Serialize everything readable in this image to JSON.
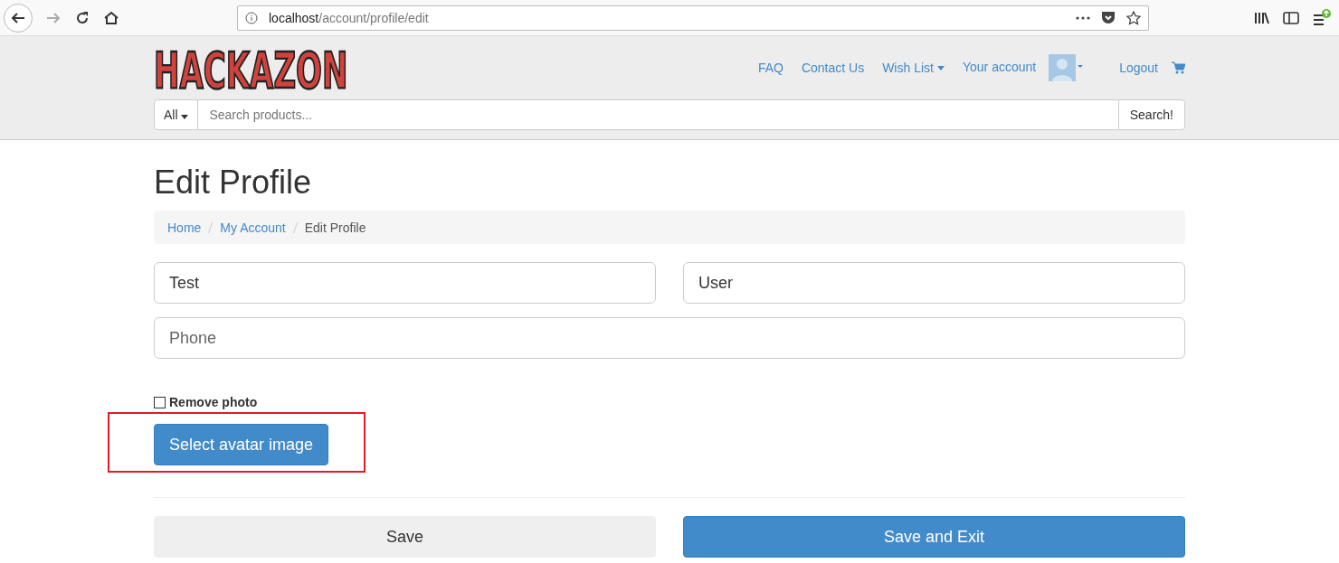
{
  "browser": {
    "url_host": "localhost",
    "url_path": "/account/profile/edit"
  },
  "header": {
    "logo": "HACKAZON",
    "nav": [
      {
        "label": "FAQ",
        "kind": "link"
      },
      {
        "label": "Contact Us",
        "kind": "link"
      },
      {
        "label": "Wish List",
        "kind": "dropdown"
      },
      {
        "label": "Your account",
        "kind": "account"
      },
      {
        "label": "Logout",
        "kind": "link"
      }
    ],
    "search": {
      "category": "All",
      "placeholder": "Search products...",
      "button": "Search!"
    }
  },
  "page_title": "Edit Profile",
  "breadcrumb": [
    {
      "label": "Home",
      "selected": false
    },
    {
      "label": "My Account",
      "selected": false
    },
    {
      "label": "Edit Profile",
      "selected": true
    }
  ],
  "fields": {
    "first_name": {
      "value": "Test"
    },
    "last_name": {
      "value": "User"
    },
    "phone": {
      "placeholder": "Phone"
    }
  },
  "remove_photo": {
    "label": "Remove photo",
    "checked": false
  },
  "avatar_button": {
    "label": "Select avatar image",
    "highlighted": true
  },
  "buttons": [
    {
      "label": "Save",
      "kind": "default"
    },
    {
      "label": "Save and Exit",
      "kind": "primary"
    }
  ]
}
